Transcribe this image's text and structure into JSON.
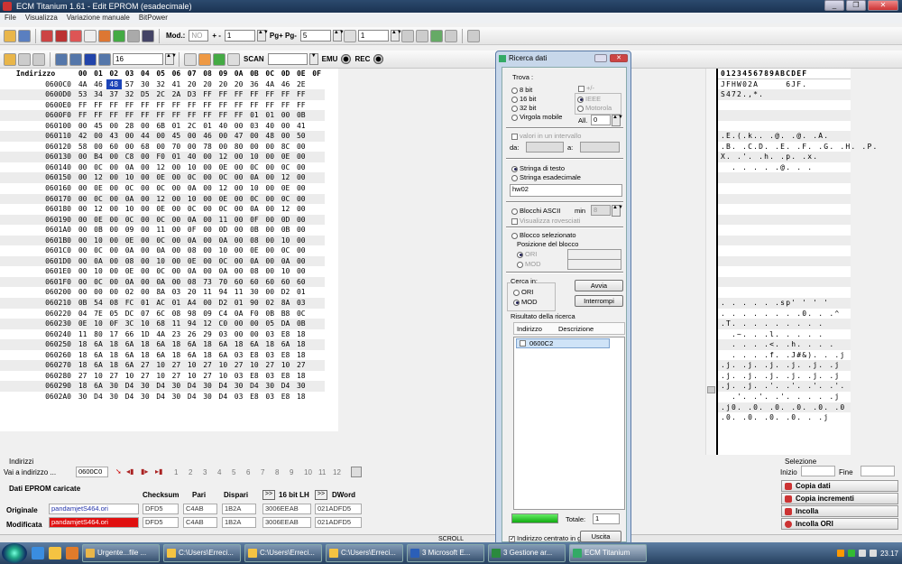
{
  "window": {
    "title": "ECM Titanium 1.61 - Edit EPROM (esadecimale)",
    "controls": [
      "_",
      "❐",
      "✕"
    ]
  },
  "menu": [
    "File",
    "Visualizza",
    "Variazione manuale",
    "BitPower"
  ],
  "toolbar": {
    "mod_label": "Mod.:",
    "mod_value": "NO",
    "plusminus": "+ -",
    "step_value": "1",
    "pg_label": "Pg+ Pg-",
    "pg_value": "5",
    "right_value": "1",
    "width_value": "16",
    "scan_label": "SCAN",
    "emu_label": "EMU",
    "rec_label": "REC"
  },
  "hex": {
    "header": {
      "addr": "Indirizzo",
      "cols": [
        "00",
        "01",
        "02",
        "03",
        "04",
        "05",
        "06",
        "07",
        "08",
        "09",
        "0A",
        "0B",
        "0C",
        "0D",
        "0E",
        "0F"
      ]
    },
    "rows": [
      {
        "addr": "0600C0",
        "b": [
          "4A",
          "46",
          "48",
          "57",
          "30",
          "32",
          "41",
          "20",
          "20",
          "20",
          "20",
          "36",
          "4A",
          "46",
          "2E",
          ""
        ]
      },
      {
        "addr": "0600D0",
        "b": [
          "53",
          "34",
          "37",
          "32",
          "D5",
          "2C",
          "2A",
          "D3",
          "FF",
          "FF",
          "FF",
          "FF",
          "FF",
          "FF",
          "FF",
          ""
        ]
      },
      {
        "addr": "0600E0",
        "b": [
          "FF",
          "FF",
          "FF",
          "FF",
          "FF",
          "FF",
          "FF",
          "FF",
          "FF",
          "FF",
          "FF",
          "FF",
          "FF",
          "FF",
          "FF",
          ""
        ]
      },
      {
        "addr": "0600F0",
        "b": [
          "FF",
          "FF",
          "FF",
          "FF",
          "FF",
          "FF",
          "FF",
          "FF",
          "FF",
          "FF",
          "FF",
          "01",
          "01",
          "00",
          "0B",
          ""
        ]
      },
      {
        "addr": "060100",
        "b": [
          "00",
          "45",
          "00",
          "28",
          "00",
          "6B",
          "01",
          "2C",
          "01",
          "40",
          "00",
          "03",
          "40",
          "00",
          "41",
          ""
        ]
      },
      {
        "addr": "060110",
        "b": [
          "42",
          "00",
          "43",
          "00",
          "44",
          "00",
          "45",
          "00",
          "46",
          "00",
          "47",
          "00",
          "48",
          "00",
          "50",
          ""
        ]
      },
      {
        "addr": "060120",
        "b": [
          "58",
          "00",
          "60",
          "00",
          "68",
          "00",
          "70",
          "00",
          "78",
          "00",
          "80",
          "00",
          "00",
          "8C",
          "00",
          ""
        ]
      },
      {
        "addr": "060130",
        "b": [
          "00",
          "B4",
          "00",
          "C8",
          "00",
          "F0",
          "01",
          "40",
          "00",
          "12",
          "00",
          "10",
          "00",
          "0E",
          "00",
          ""
        ]
      },
      {
        "addr": "060140",
        "b": [
          "00",
          "0C",
          "00",
          "0A",
          "00",
          "12",
          "00",
          "10",
          "00",
          "0E",
          "00",
          "0C",
          "00",
          "0C",
          "00",
          ""
        ]
      },
      {
        "addr": "060150",
        "b": [
          "00",
          "12",
          "00",
          "10",
          "00",
          "0E",
          "00",
          "0C",
          "00",
          "0C",
          "00",
          "0A",
          "00",
          "12",
          "00",
          ""
        ]
      },
      {
        "addr": "060160",
        "b": [
          "00",
          "0E",
          "00",
          "0C",
          "00",
          "0C",
          "00",
          "0A",
          "00",
          "12",
          "00",
          "10",
          "00",
          "0E",
          "00",
          ""
        ]
      },
      {
        "addr": "060170",
        "b": [
          "00",
          "0C",
          "00",
          "0A",
          "00",
          "12",
          "00",
          "10",
          "00",
          "0E",
          "00",
          "0C",
          "00",
          "0C",
          "00",
          ""
        ]
      },
      {
        "addr": "060180",
        "b": [
          "00",
          "12",
          "00",
          "10",
          "00",
          "0E",
          "00",
          "0C",
          "00",
          "0C",
          "00",
          "0A",
          "00",
          "12",
          "00",
          ""
        ]
      },
      {
        "addr": "060190",
        "b": [
          "00",
          "0E",
          "00",
          "0C",
          "00",
          "0C",
          "00",
          "0A",
          "00",
          "11",
          "00",
          "0F",
          "00",
          "0D",
          "00",
          ""
        ]
      },
      {
        "addr": "0601A0",
        "b": [
          "00",
          "0B",
          "00",
          "09",
          "00",
          "11",
          "00",
          "0F",
          "00",
          "0D",
          "00",
          "0B",
          "00",
          "0B",
          "00",
          ""
        ]
      },
      {
        "addr": "0601B0",
        "b": [
          "00",
          "10",
          "00",
          "0E",
          "00",
          "0C",
          "00",
          "0A",
          "00",
          "0A",
          "00",
          "08",
          "00",
          "10",
          "00",
          ""
        ]
      },
      {
        "addr": "0601C0",
        "b": [
          "00",
          "0C",
          "00",
          "0A",
          "00",
          "0A",
          "00",
          "08",
          "00",
          "10",
          "00",
          "0E",
          "00",
          "0C",
          "00",
          ""
        ]
      },
      {
        "addr": "0601D0",
        "b": [
          "00",
          "0A",
          "00",
          "08",
          "00",
          "10",
          "00",
          "0E",
          "00",
          "0C",
          "00",
          "0A",
          "00",
          "0A",
          "00",
          ""
        ]
      },
      {
        "addr": "0601E0",
        "b": [
          "00",
          "10",
          "00",
          "0E",
          "00",
          "0C",
          "00",
          "0A",
          "00",
          "0A",
          "00",
          "08",
          "00",
          "10",
          "00",
          ""
        ]
      },
      {
        "addr": "0601F0",
        "b": [
          "00",
          "0C",
          "00",
          "0A",
          "00",
          "0A",
          "00",
          "08",
          "73",
          "70",
          "60",
          "60",
          "60",
          "60",
          "60",
          ""
        ]
      },
      {
        "addr": "060200",
        "b": [
          "00",
          "00",
          "00",
          "02",
          "00",
          "8A",
          "03",
          "20",
          "11",
          "94",
          "11",
          "30",
          "00",
          "D2",
          "01",
          ""
        ]
      },
      {
        "addr": "060210",
        "b": [
          "0B",
          "54",
          "08",
          "FC",
          "01",
          "AC",
          "01",
          "A4",
          "00",
          "D2",
          "01",
          "90",
          "02",
          "8A",
          "03",
          ""
        ]
      },
      {
        "addr": "060220",
        "b": [
          "04",
          "7E",
          "05",
          "DC",
          "07",
          "6C",
          "08",
          "98",
          "09",
          "C4",
          "0A",
          "F0",
          "0B",
          "B8",
          "0C",
          ""
        ]
      },
      {
        "addr": "060230",
        "b": [
          "0E",
          "10",
          "0F",
          "3C",
          "10",
          "68",
          "11",
          "94",
          "12",
          "C0",
          "00",
          "00",
          "05",
          "DA",
          "0B",
          ""
        ]
      },
      {
        "addr": "060240",
        "b": [
          "11",
          "80",
          "17",
          "66",
          "1D",
          "4A",
          "23",
          "26",
          "29",
          "03",
          "00",
          "00",
          "03",
          "E8",
          "18",
          ""
        ]
      },
      {
        "addr": "060250",
        "b": [
          "18",
          "6A",
          "18",
          "6A",
          "18",
          "6A",
          "18",
          "6A",
          "18",
          "6A",
          "18",
          "6A",
          "18",
          "6A",
          "18",
          ""
        ]
      },
      {
        "addr": "060260",
        "b": [
          "18",
          "6A",
          "18",
          "6A",
          "18",
          "6A",
          "18",
          "6A",
          "18",
          "6A",
          "03",
          "E8",
          "03",
          "E8",
          "18",
          ""
        ]
      },
      {
        "addr": "060270",
        "b": [
          "18",
          "6A",
          "18",
          "6A",
          "27",
          "10",
          "27",
          "10",
          "27",
          "10",
          "27",
          "10",
          "27",
          "10",
          "27",
          ""
        ]
      },
      {
        "addr": "060280",
        "b": [
          "27",
          "10",
          "27",
          "10",
          "27",
          "10",
          "27",
          "10",
          "27",
          "10",
          "03",
          "E8",
          "03",
          "E8",
          "18",
          ""
        ]
      },
      {
        "addr": "060290",
        "b": [
          "18",
          "6A",
          "30",
          "D4",
          "30",
          "D4",
          "30",
          "D4",
          "30",
          "D4",
          "30",
          "D4",
          "30",
          "D4",
          "30",
          ""
        ]
      },
      {
        "addr": "0602A0",
        "b": [
          "30",
          "D4",
          "30",
          "D4",
          "30",
          "D4",
          "30",
          "D4",
          "30",
          "D4",
          "03",
          "E8",
          "03",
          "E8",
          "18",
          ""
        ]
      }
    ],
    "selected_cell": {
      "row": 0,
      "col": 2
    }
  },
  "ascii": {
    "header": "0123456789ABCDEF",
    "rows": [
      "JFHW02A     6JF.",
      "S472.,*.",
      "",
      "",
      "",
      ".E.(.k.. .@. .@. .A.",
      ".B. .C.D. .E. .F. .G. .H. .P.",
      "X. .'. .h. .p. .x.",
      "  . . . . .@. . .",
      "",
      "",
      "",
      "",
      "",
      "",
      "",
      "",
      "",
      "",
      "",
      "",
      ". . . . . .sp' ' ' '",
      ". . . . . . . .0. . .^",
      ".T. . . . . . . . .",
      "  .~. . .l. . . . .",
      "  . . . .<. .h. . . .",
      "  . . . .f. .J#&). . .j",
      ".j. .j. .j. .j. .j. .j",
      ".j. .j. .j. .j. .j. .j",
      ".j. .j. .'. .'. .'. .'.",
      "  .'. .'. .'. . . . .j",
      ".j0. .0. .0. .0. .0. .0",
      ".0. .0. .0. .0. . .j"
    ]
  },
  "search_dialog": {
    "title": "Ricerca dati",
    "trova_label": "Trova :",
    "options": [
      "8 bit",
      "16 bit",
      "32 bit",
      "Virgola mobile"
    ],
    "sign_label": "+/-",
    "float_opts": [
      "IEEE",
      "Motorola"
    ],
    "all_label": "All.",
    "all_value": "0",
    "range_label": "valori in un intervallo",
    "da_label": "da:",
    "a_label": "a:",
    "text_opts": [
      "Stringa di testo",
      "Stringa esadecimale"
    ],
    "search_text": "hw02",
    "ascii_blocks": "Blocchi ASCII",
    "min_label": "min",
    "min_value": "8",
    "reversed_label": "Visualizza rovesciati",
    "block_sel_label": "Blocco selezionato",
    "block_pos_label": "Posizione del blocco",
    "block_opts": [
      "ORI",
      "MOD"
    ],
    "search_in_label": "Cerca in:",
    "search_in_opts": [
      "ORI",
      "MOD"
    ],
    "start_btn": "Avvia",
    "stop_btn": "Interrompi",
    "result_label": "Risultato della ricerca",
    "col_addr": "Indirizzo",
    "col_desc": "Descrizione",
    "result_item": "0600C2",
    "total_label": "Totale:",
    "total_value": "1",
    "center_label": "Indirizzo centrato in grafica",
    "exit_btn": "Uscita"
  },
  "bottom": {
    "addr_group": "Indirizzi",
    "goto_label": "Vai a indirizzo ...",
    "goto_value": "0600C0",
    "nav_numbers": [
      "1",
      "2",
      "3",
      "4",
      "5",
      "6",
      "7",
      "8",
      "9",
      "10",
      "11",
      "12"
    ],
    "eprom_label": "Dati EPROM caricate",
    "col_checksum": "Checksum",
    "col_pari": "Pari",
    "col_dispari": "Dispari",
    "col_16bit": "16 bit LH",
    "col_dword": "DWord",
    "original_label": "Originale",
    "original_file": "pandamjetS464.ori",
    "original_vals": [
      "DFD5",
      "C4AB",
      "1B2A",
      "3006EEAB",
      "021ADFD5"
    ],
    "modified_label": "Modificata",
    "modified_file": "pandamjetS464.ori",
    "modified_vals": [
      "DFD5",
      "C4AB",
      "1B2A",
      "3006EEAB",
      "021ADFD5"
    ],
    "selection_label": "Selezione",
    "start_label": "Inizio",
    "end_label": "Fine",
    "btn_copy_data": "Copia dati",
    "btn_copy_incr": "Copia incrementi",
    "btn_paste": "Incolla",
    "btn_paste_ori": "Incolla ORI"
  },
  "statusbar": {
    "text": "SCROLL"
  },
  "taskbar": {
    "items": [
      "Urgente...file ...",
      "C:\\Users\\Erreci...",
      "C:\\Users\\Erreci...",
      "C:\\Users\\Erreci...",
      "3 Microsoft E...",
      "3 Gestione ar...",
      "ECM Titanium"
    ],
    "clock": "23.17"
  }
}
